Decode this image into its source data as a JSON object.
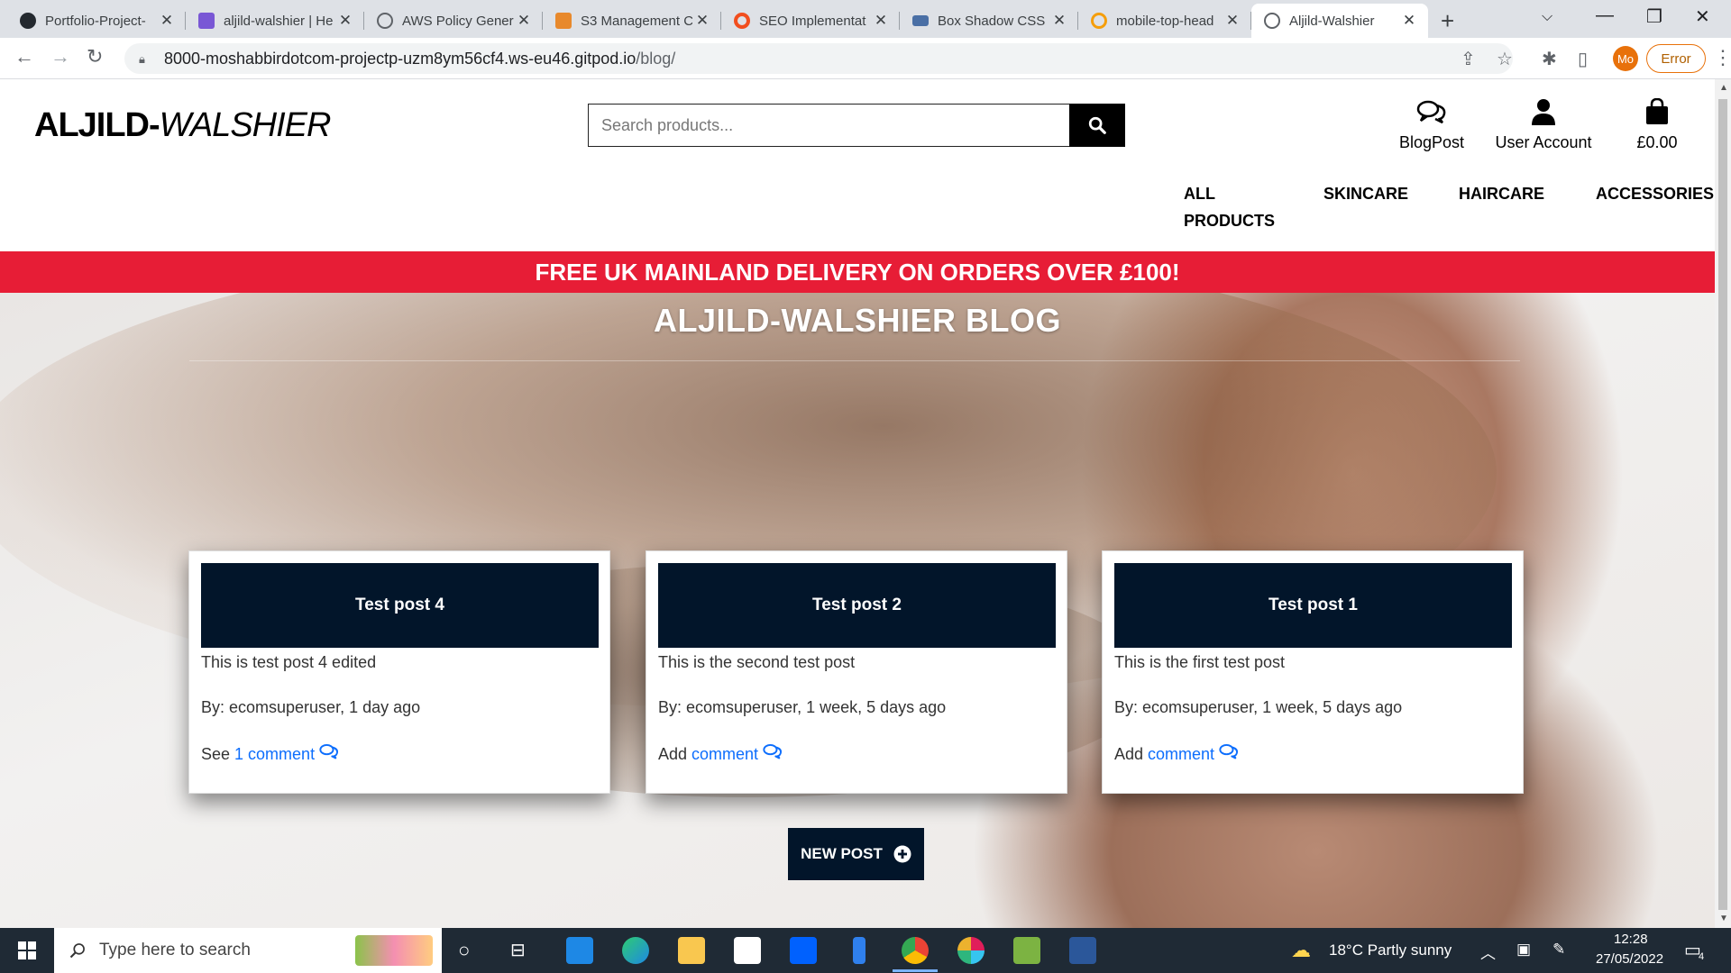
{
  "browser": {
    "tabs": [
      {
        "title": "Portfolio-Project-",
        "fav_color": "#24292f"
      },
      {
        "title": "aljild-walshier | He",
        "fav_color": "#7957d5"
      },
      {
        "title": "AWS Policy Gener",
        "fav_color": "#5f6368"
      },
      {
        "title": "S3 Management C",
        "fav_color": "#e8892c"
      },
      {
        "title": "SEO Implementat",
        "fav_color": "#f24e1e"
      },
      {
        "title": "Box Shadow CSS",
        "fav_color": "#4a6fa5"
      },
      {
        "title": "mobile-top-head",
        "fav_color": "#f59e0b"
      },
      {
        "title": "Aljild-Walshier",
        "fav_color": "#5f6368"
      }
    ],
    "url_host": "8000-moshabbirdotcom-projectp-uzm8ym56cf4.ws-eu46.gitpod.io",
    "url_path": "/blog/",
    "profile_initials": "Mo",
    "error_label": "Error"
  },
  "header": {
    "logo_bold": "ALJILD-",
    "logo_italic": "WALSHIER",
    "search_placeholder": "Search products...",
    "blogpost_label": "BlogPost",
    "account_label": "User Account",
    "cart_total": "£0.00",
    "nav": [
      "ALL PRODUCTS",
      "SKINCARE",
      "HAIRCARE",
      "ACCESSORIES"
    ]
  },
  "banner": {
    "text": "FREE UK MAINLAND DELIVERY ON ORDERS OVER £100!"
  },
  "blog": {
    "title": "ALJILD-WALSHIER BLOG",
    "posts": [
      {
        "title": "Test post 4",
        "excerpt": "This is test post 4 edited",
        "byline": "By: ecomsuperuser, 1 day ago",
        "comment_prefix": "See ",
        "comment_link": "1 comment"
      },
      {
        "title": "Test post 2",
        "excerpt": "This is the second test post",
        "byline": "By: ecomsuperuser, 1 week, 5 days ago",
        "comment_prefix": "Add ",
        "comment_link": "comment"
      },
      {
        "title": "Test post 1",
        "excerpt": "This is the first test post",
        "byline": "By: ecomsuperuser, 1 week, 5 days ago",
        "comment_prefix": "Add ",
        "comment_link": "comment"
      }
    ],
    "new_post_label": "NEW POST"
  },
  "taskbar": {
    "search_placeholder": "Type here to search",
    "weather": "18°C  Partly sunny",
    "time": "12:28",
    "date": "27/05/2022",
    "notifications": "4"
  },
  "colors": {
    "navy": "#02152a",
    "banner_red": "#e71d36",
    "link_blue": "#0d6efd"
  }
}
